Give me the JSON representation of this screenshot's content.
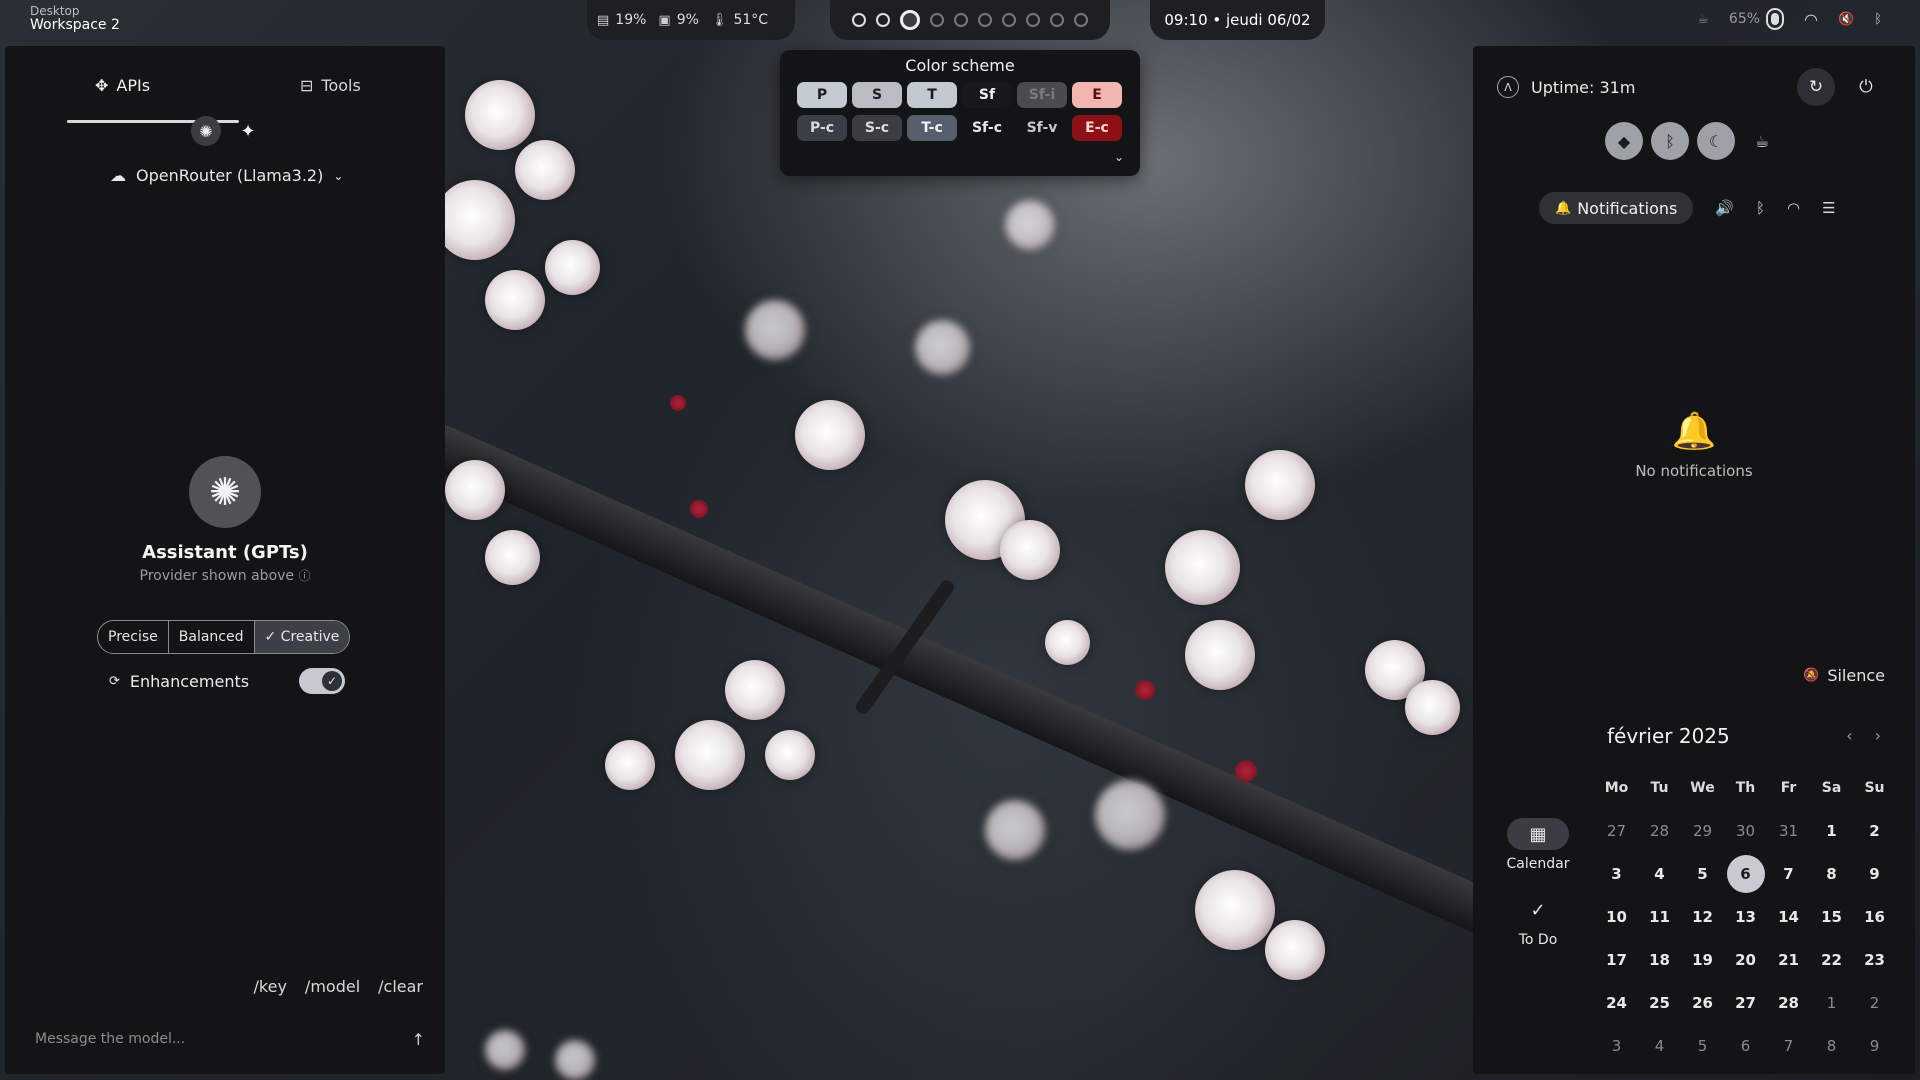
{
  "topbar": {
    "workspace_line1": "Desktop",
    "workspace_line2": "Workspace 2",
    "resources": [
      {
        "icon": "ram-icon",
        "value": "19%"
      },
      {
        "icon": "cpu-icon",
        "value": "9%"
      },
      {
        "icon": "temperature-icon",
        "value": "51°C"
      }
    ],
    "workspaces_count": 10,
    "active_workspace": 3,
    "clock": "09:10 • jeudi 06/02",
    "battery": "65%"
  },
  "left": {
    "tabs": [
      {
        "label": "APIs",
        "icon": "api-icon"
      },
      {
        "label": "Tools",
        "icon": "toolbox-icon"
      }
    ],
    "model": "OpenRouter (Llama3.2)",
    "assistant_name": "Assistant (GPTs)",
    "assistant_sub": "Provider shown above",
    "temperature_options": [
      "Precise",
      "Balanced",
      "✓ Creative"
    ],
    "enhancements_label": "Enhancements",
    "enhancements_on": true,
    "commands": [
      "/key",
      "/model",
      "/clear"
    ],
    "message_placeholder": "Message the model..."
  },
  "color_scheme": {
    "title": "Color scheme",
    "row1": [
      {
        "label": "P",
        "bg": "#c3cad3",
        "fg": "#1b1d21"
      },
      {
        "label": "S",
        "bg": "#b9bdc3",
        "fg": "#1b1d21"
      },
      {
        "label": "T",
        "bg": "#c2c9d1",
        "fg": "#1b1d21"
      },
      {
        "label": "Sf",
        "bg": "#17181b",
        "fg": "#f0f0f0"
      },
      {
        "label": "Sf-i",
        "bg": "#4a4b4f",
        "fg": "#7a7b7e"
      },
      {
        "label": "E",
        "bg": "#f2b6b1",
        "fg": "#5a1010"
      }
    ],
    "row2": [
      {
        "label": "P-c",
        "bg": "#3a3f47",
        "fg": "#d8dce2"
      },
      {
        "label": "S-c",
        "bg": "#3a3d42",
        "fg": "#d8dce2"
      },
      {
        "label": "T-c",
        "bg": "#56606c",
        "fg": "#f0f3f6"
      },
      {
        "label": "Sf-c",
        "bg": "#131417",
        "fg": "#e8e8e8"
      },
      {
        "label": "Sf-v",
        "bg": "#131417",
        "fg": "#c8c8c8"
      },
      {
        "label": "E-c",
        "bg": "#8c1014",
        "fg": "#ffd8d6"
      }
    ]
  },
  "right": {
    "uptime": "Uptime: 31m",
    "notifications_tab": "Notifications",
    "no_notifications": "No notifications",
    "silence": "Silence",
    "side_tabs": [
      {
        "label": "Calendar",
        "icon": "calendar-icon"
      },
      {
        "label": "To Do",
        "icon": "check-icon"
      }
    ],
    "calendar": {
      "month": "février 2025",
      "weekdays": [
        "Mo",
        "Tu",
        "We",
        "Th",
        "Fr",
        "Sa",
        "Su"
      ],
      "days": [
        {
          "d": "27",
          "dim": true
        },
        {
          "d": "28",
          "dim": true
        },
        {
          "d": "29",
          "dim": true
        },
        {
          "d": "30",
          "dim": true
        },
        {
          "d": "31",
          "dim": true
        },
        {
          "d": "1"
        },
        {
          "d": "2"
        },
        {
          "d": "3"
        },
        {
          "d": "4"
        },
        {
          "d": "5"
        },
        {
          "d": "6",
          "today": true
        },
        {
          "d": "7"
        },
        {
          "d": "8"
        },
        {
          "d": "9"
        },
        {
          "d": "10"
        },
        {
          "d": "11"
        },
        {
          "d": "12"
        },
        {
          "d": "13"
        },
        {
          "d": "14"
        },
        {
          "d": "15"
        },
        {
          "d": "16"
        },
        {
          "d": "17"
        },
        {
          "d": "18"
        },
        {
          "d": "19"
        },
        {
          "d": "20"
        },
        {
          "d": "21"
        },
        {
          "d": "22"
        },
        {
          "d": "23"
        },
        {
          "d": "24"
        },
        {
          "d": "25"
        },
        {
          "d": "26"
        },
        {
          "d": "27"
        },
        {
          "d": "28"
        },
        {
          "d": "1",
          "dim": true
        },
        {
          "d": "2",
          "dim": true
        },
        {
          "d": "3",
          "dim": true
        },
        {
          "d": "4",
          "dim": true
        },
        {
          "d": "5",
          "dim": true
        },
        {
          "d": "6",
          "dim": true
        },
        {
          "d": "7",
          "dim": true
        },
        {
          "d": "8",
          "dim": true
        },
        {
          "d": "9",
          "dim": true
        }
      ]
    }
  }
}
